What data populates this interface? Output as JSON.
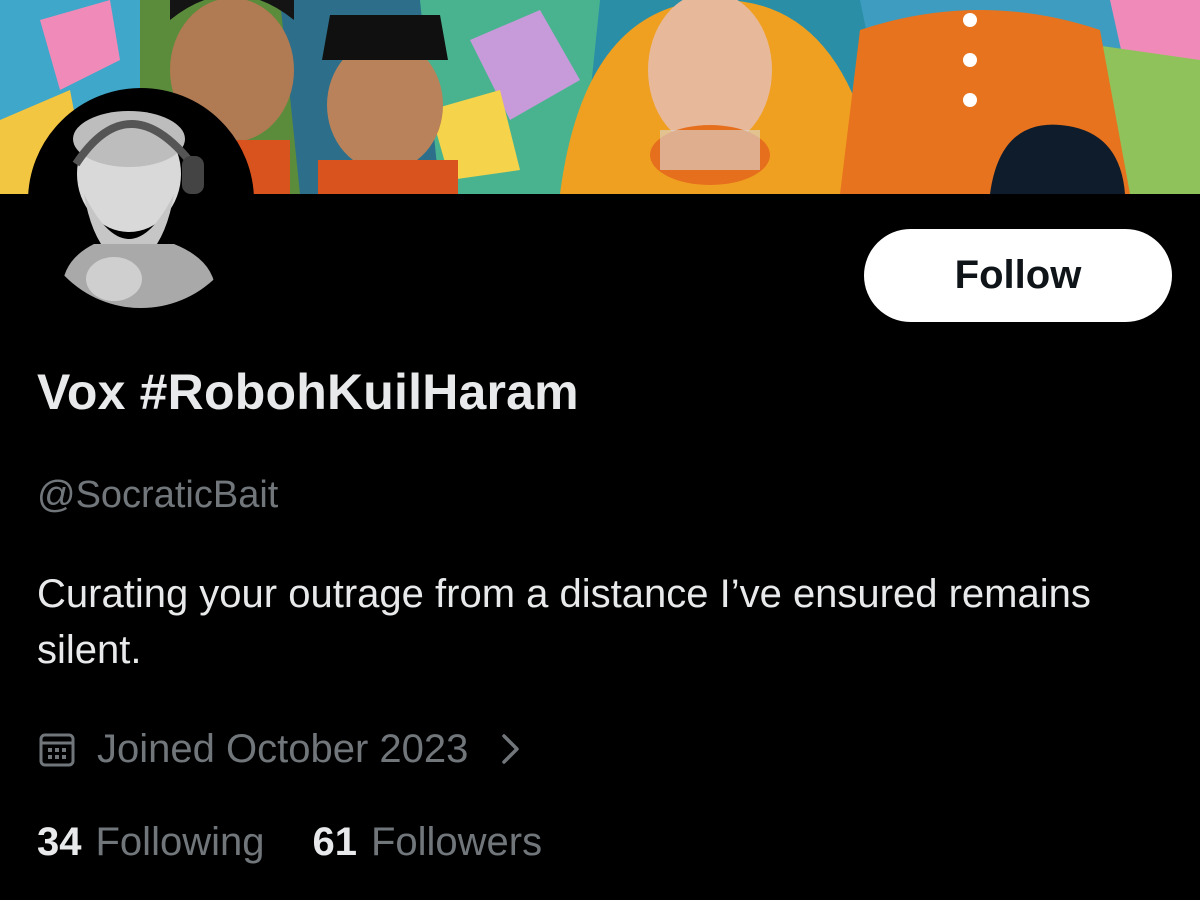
{
  "profile": {
    "display_name": "Vox #RobohKuilHaram",
    "handle": "@SocraticBait",
    "bio": "Curating your outrage from a distance I’ve ensured remains silent.",
    "joined": "Joined October 2023"
  },
  "actions": {
    "follow_label": "Follow"
  },
  "stats": {
    "following_count": "34",
    "following_label": "Following",
    "followers_count": "61",
    "followers_label": "Followers"
  },
  "icons": {
    "joined": "calendar-icon",
    "joined_more": "chevron-right-icon"
  },
  "colors": {
    "background": "#000000",
    "primary_text": "#e7e9ea",
    "secondary_text": "#71767b",
    "follow_button_bg": "#ffffff",
    "follow_button_text": "#0f1419"
  }
}
